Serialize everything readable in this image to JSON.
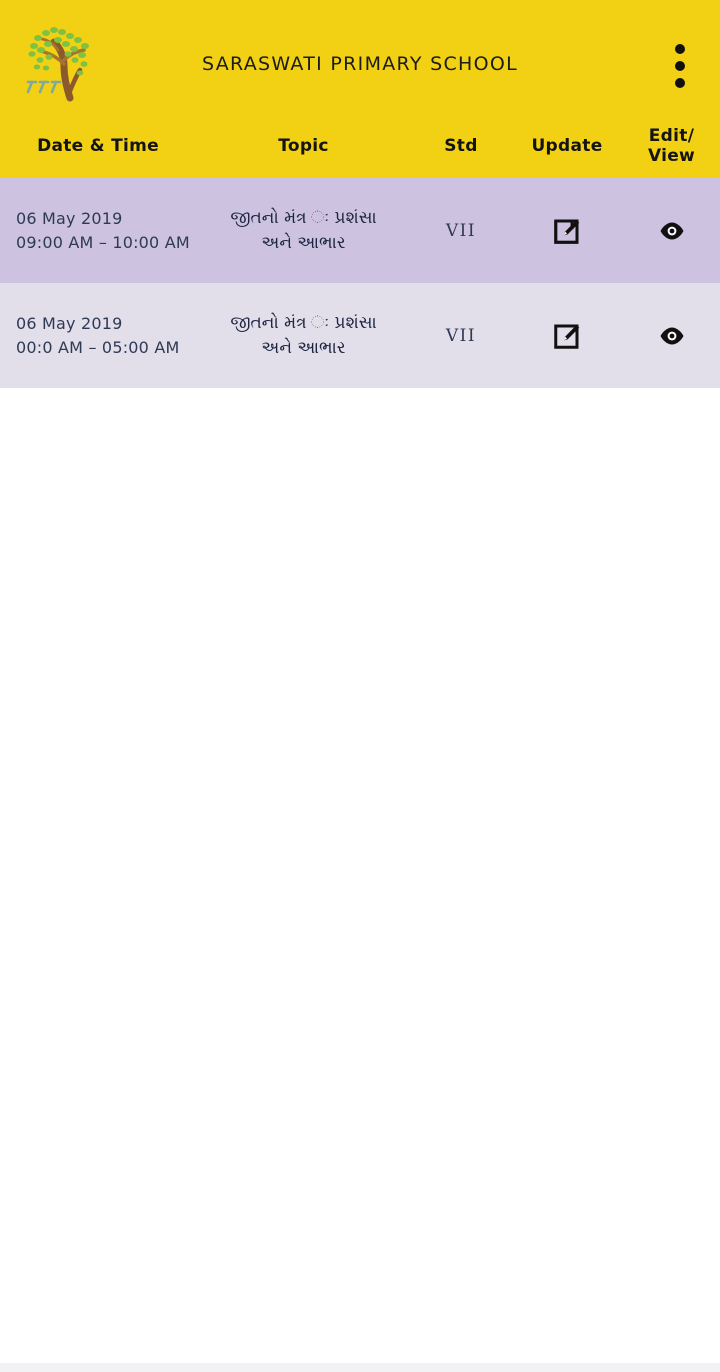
{
  "statusbar": {
    "left_text": "",
    "right_text": ""
  },
  "appbar": {
    "title": "SARASWATI PRIMARY SCHOOL",
    "logo_icon": "tree-logo-icon",
    "overflow_icon": "three-dot-overflow-icon",
    "background_color": "#F2D014"
  },
  "table": {
    "headers": {
      "date_time": "Date & Time",
      "topic": "Topic",
      "std": "Std",
      "update": "Update",
      "edit_view": "Edit/\nView",
      "edit_view_line1": "Edit/",
      "edit_view_line2": "View"
    },
    "row_colors": {
      "odd": "#CDC2DF",
      "even": "#E2DEEA"
    },
    "rows": [
      {
        "date": "06 May 2019",
        "time": "09:00 AM – 10:00 AM",
        "topic_line1": "જીતનો મંત્ર ઃ પ્રશંસા",
        "topic_line2": "અને આભાર",
        "std": "VII",
        "update_icon": "edit-pencil-square-icon",
        "view_icon": "eye-icon"
      },
      {
        "date": "06 May 2019",
        "time": "00:0 AM – 05:00 AM",
        "topic_line1": "જીતનો મંત્ર ઃ પ્રશંસા",
        "topic_line2": "અને આભાર",
        "std": "VII",
        "update_icon": "edit-pencil-square-icon",
        "view_icon": "eye-icon"
      }
    ]
  },
  "theme": {
    "accent": "#F2D014",
    "text_dark": "#2E3A55",
    "page_background": "#FFFFFF"
  }
}
